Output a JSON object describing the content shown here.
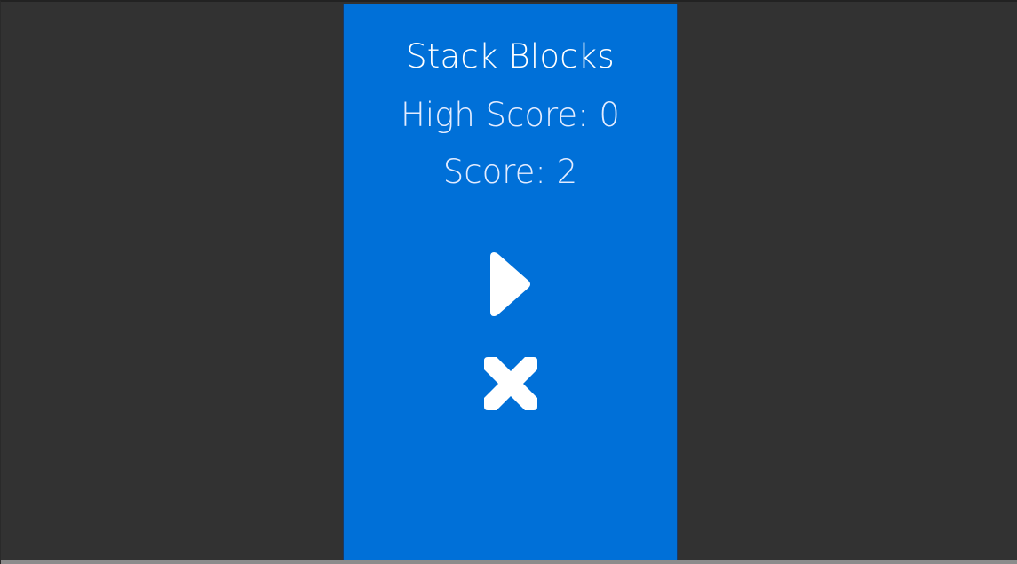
{
  "game": {
    "title": "Stack Blocks",
    "high_score_text": "High Score: 0",
    "score_text": "Score: 2"
  },
  "buttons": {
    "play_icon": "play-icon",
    "close_icon": "close-icon"
  },
  "colors": {
    "panel_background": "#0070d8",
    "outer_background": "#323232",
    "text": "#ffffff",
    "icon": "#ffffff"
  }
}
